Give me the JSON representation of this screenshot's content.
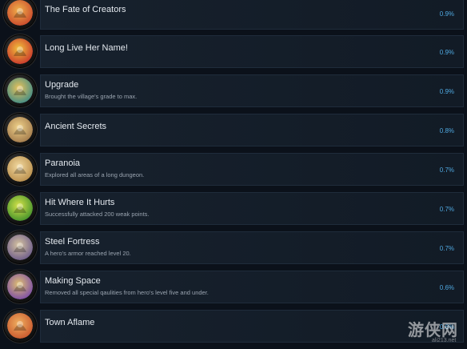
{
  "achievements": [
    {
      "title": "The Fate of Creators",
      "description": "",
      "percent": "0.9%",
      "icon": "fate-of-creators-icon",
      "colors": [
        "#c9462b",
        "#f0b04a"
      ]
    },
    {
      "title": "Long Live Her Name!",
      "description": "",
      "percent": "0.9%",
      "icon": "long-live-her-name-icon",
      "colors": [
        "#c8342c",
        "#f2c03b"
      ]
    },
    {
      "title": "Upgrade",
      "description": "Brought the village's grade to max.",
      "percent": "0.9%",
      "icon": "upgrade-icon",
      "colors": [
        "#3d8b86",
        "#e9c25a"
      ]
    },
    {
      "title": "Ancient Secrets",
      "description": "",
      "percent": "0.8%",
      "icon": "ancient-secrets-icon",
      "colors": [
        "#a0784a",
        "#f0d28a"
      ]
    },
    {
      "title": "Paranoia",
      "description": "Explored all areas of a long dungeon.",
      "percent": "0.7%",
      "icon": "paranoia-icon",
      "colors": [
        "#b88d4a",
        "#f2d9a0"
      ]
    },
    {
      "title": "Hit Where It Hurts",
      "description": "Successfully attacked 200 weak points.",
      "percent": "0.7%",
      "icon": "hit-where-it-hurts-icon",
      "colors": [
        "#3f8f2a",
        "#d6e34a"
      ]
    },
    {
      "title": "Steel Fortress",
      "description": "A hero's armor reached level 20.",
      "percent": "0.7%",
      "icon": "steel-fortress-icon",
      "colors": [
        "#6b5a8a",
        "#d7c4a0"
      ]
    },
    {
      "title": "Making Space",
      "description": "Removed all special qaulities from hero's level five and under.",
      "percent": "0.6%",
      "icon": "making-space-icon",
      "colors": [
        "#7a4aa8",
        "#e0c070"
      ]
    },
    {
      "title": "Town Aflame",
      "description": "",
      "percent": "0.6%",
      "icon": "town-aflame-icon",
      "colors": [
        "#c8562c",
        "#f0b060"
      ]
    }
  ],
  "watermark": {
    "text": "游侠网",
    "subtext": "ali213.net"
  }
}
